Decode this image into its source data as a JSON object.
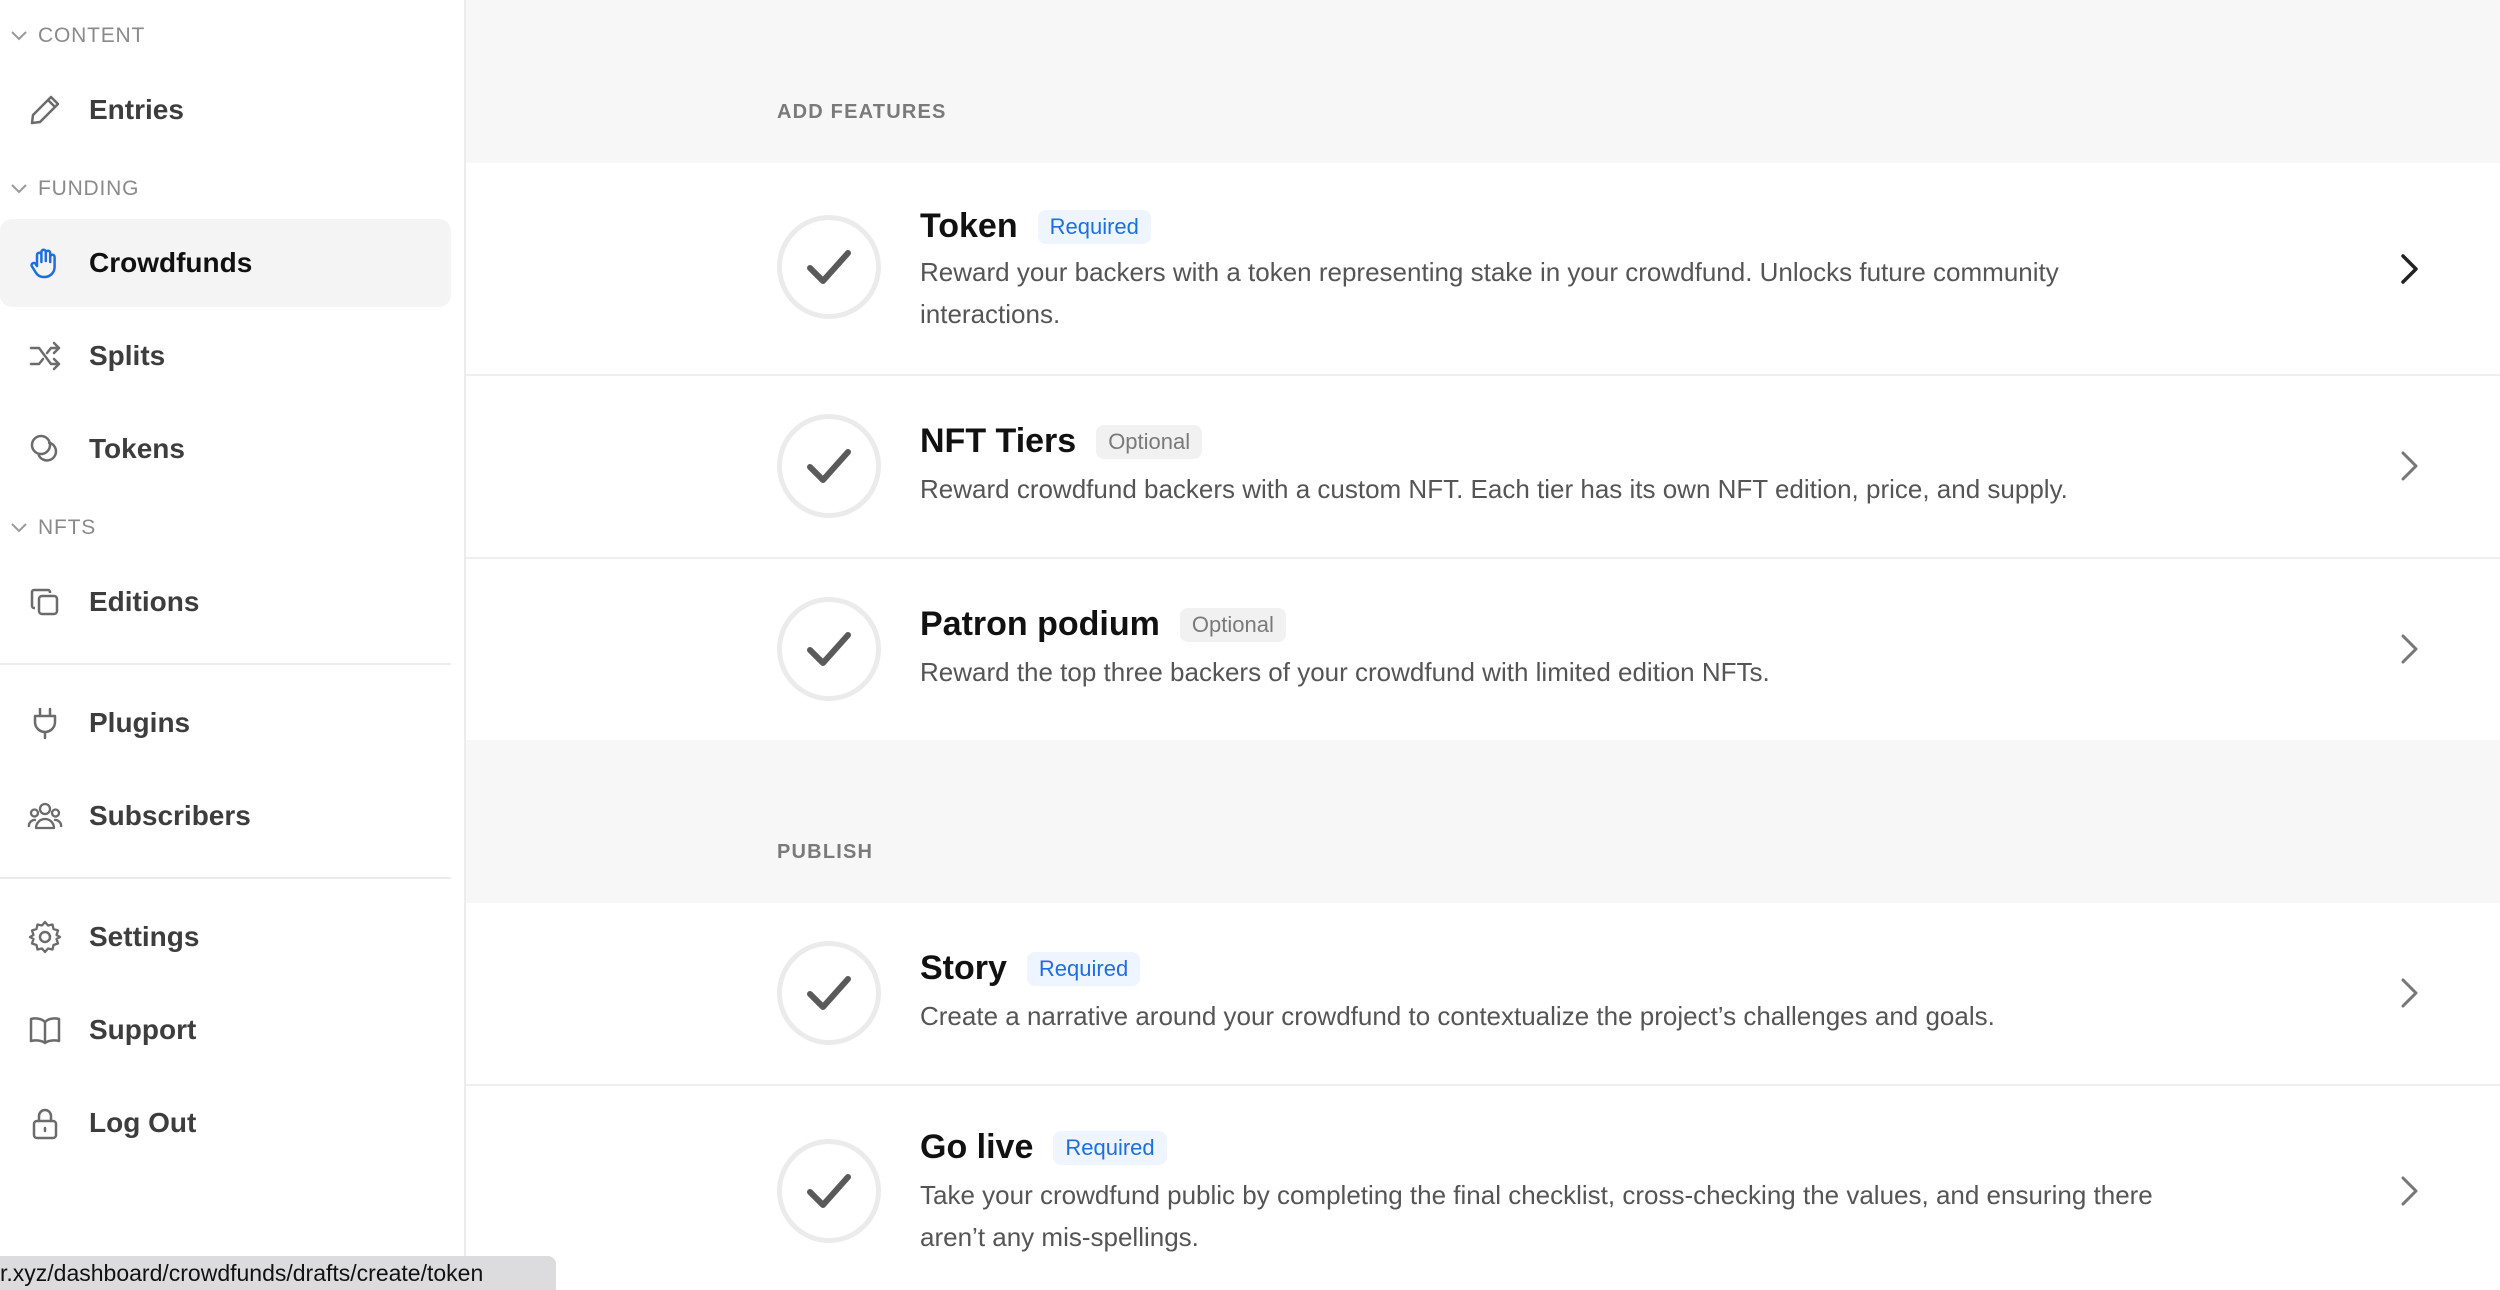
{
  "sidebar": {
    "sections": {
      "content": "CONTENT",
      "funding": "FUNDING",
      "nfts": "NFTS"
    },
    "items": {
      "entries": "Entries",
      "crowdfunds": "Crowdfunds",
      "splits": "Splits",
      "tokens": "Tokens",
      "editions": "Editions",
      "plugins": "Plugins",
      "subscribers": "Subscribers",
      "settings": "Settings",
      "support": "Support",
      "logout": "Log Out"
    },
    "active_item": "Crowdfunds",
    "accent_color": "#1d6fe0"
  },
  "main": {
    "add_features": {
      "label": "ADD FEATURES",
      "cards": [
        {
          "title": "Token",
          "badge": "Required",
          "description": "Reward your backers with a token representing stake in your crowdfund. Unlocks future community interactions."
        },
        {
          "title": "NFT Tiers",
          "badge": "Optional",
          "description": "Reward crowdfund backers with a custom NFT. Each tier has its own NFT edition, price, and supply."
        },
        {
          "title": "Patron podium",
          "badge": "Optional",
          "description": "Reward the top three backers of your crowdfund with limited edition NFTs."
        }
      ]
    },
    "publish": {
      "label": "PUBLISH",
      "cards": [
        {
          "title": "Story",
          "badge": "Required",
          "description": "Create a narrative around your crowdfund to contextualize the project’s challenges and goals."
        },
        {
          "title": "Go live",
          "badge": "Required",
          "description": "Take your crowdfund public by completing the final checklist, cross-checking the values, and ensuring there aren’t any mis-spellings."
        }
      ]
    }
  },
  "status_bar": {
    "url": "r.xyz/dashboard/crowdfunds/drafts/create/token"
  }
}
